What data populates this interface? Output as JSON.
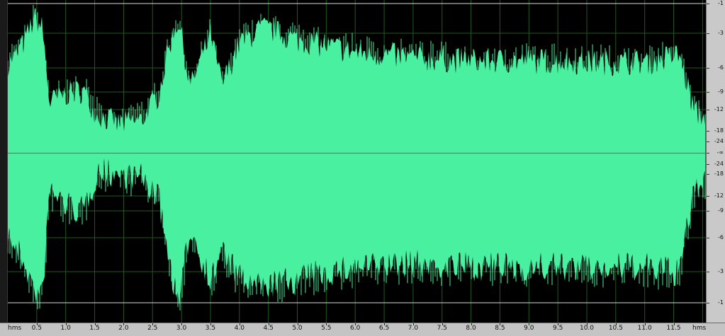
{
  "colors": {
    "background": "#000000",
    "waveform": "#49f0a0",
    "grid": "#1f5a1f",
    "centerline": "#2f8a5a",
    "clip_line": "#d8d8d8",
    "ruler": "#c9c9c9"
  },
  "time_ruler": {
    "start_unit": "hms",
    "end_unit": "hms",
    "ticks": [
      "0.5",
      "1.0",
      "1.5",
      "2.0",
      "2.5",
      "3.0",
      "3.5",
      "4.0",
      "4.5",
      "5.0",
      "5.5",
      "6.0",
      "6.5",
      "7.0",
      "7.5",
      "8.0",
      "8.5",
      "9.0",
      "9.5",
      "10.0",
      "10.5",
      "11.0",
      "11.5"
    ]
  },
  "db_ruler": {
    "labels": [
      "-1",
      "-3",
      "-6",
      "-9",
      "-12",
      "-18",
      "-24",
      "-∞",
      "-24",
      "-18",
      "-12",
      "-9",
      "-6",
      "-3",
      "-1"
    ]
  },
  "waveform": {
    "envelope": [
      {
        "t": 0.0,
        "top": 0.55,
        "bot": 0.5
      },
      {
        "t": 0.15,
        "top": 0.62,
        "bot": 0.6
      },
      {
        "t": 0.3,
        "top": 0.72,
        "bot": 0.7
      },
      {
        "t": 0.45,
        "top": 0.86,
        "bot": 0.88
      },
      {
        "t": 0.6,
        "top": 0.8,
        "bot": 0.92
      },
      {
        "t": 0.72,
        "top": 0.3,
        "bot": 0.2
      },
      {
        "t": 1.0,
        "top": 0.36,
        "bot": 0.3
      },
      {
        "t": 1.3,
        "top": 0.38,
        "bot": 0.35
      },
      {
        "t": 1.55,
        "top": 0.22,
        "bot": 0.08
      },
      {
        "t": 1.9,
        "top": 0.16,
        "bot": 0.1
      },
      {
        "t": 2.3,
        "top": 0.18,
        "bot": 0.12
      },
      {
        "t": 2.6,
        "top": 0.35,
        "bot": 0.25
      },
      {
        "t": 2.8,
        "top": 0.7,
        "bot": 0.7
      },
      {
        "t": 2.95,
        "top": 0.86,
        "bot": 0.98
      },
      {
        "t": 3.15,
        "top": 0.4,
        "bot": 0.45
      },
      {
        "t": 3.5,
        "top": 0.75,
        "bot": 0.82
      },
      {
        "t": 3.7,
        "top": 0.42,
        "bot": 0.6
      },
      {
        "t": 4.0,
        "top": 0.7,
        "bot": 0.8
      },
      {
        "t": 4.4,
        "top": 0.8,
        "bot": 0.85
      },
      {
        "t": 5.0,
        "top": 0.72,
        "bot": 0.8
      },
      {
        "t": 6.0,
        "top": 0.64,
        "bot": 0.72
      },
      {
        "t": 7.0,
        "top": 0.6,
        "bot": 0.7
      },
      {
        "t": 8.0,
        "top": 0.58,
        "bot": 0.72
      },
      {
        "t": 9.0,
        "top": 0.58,
        "bot": 0.72
      },
      {
        "t": 10.0,
        "top": 0.57,
        "bot": 0.72
      },
      {
        "t": 11.0,
        "top": 0.57,
        "bot": 0.72
      },
      {
        "t": 11.6,
        "top": 0.62,
        "bot": 0.76
      },
      {
        "t": 11.85,
        "top": 0.25,
        "bot": 0.2
      },
      {
        "t": 12.0,
        "top": 0.2,
        "bot": 0.15
      }
    ]
  }
}
